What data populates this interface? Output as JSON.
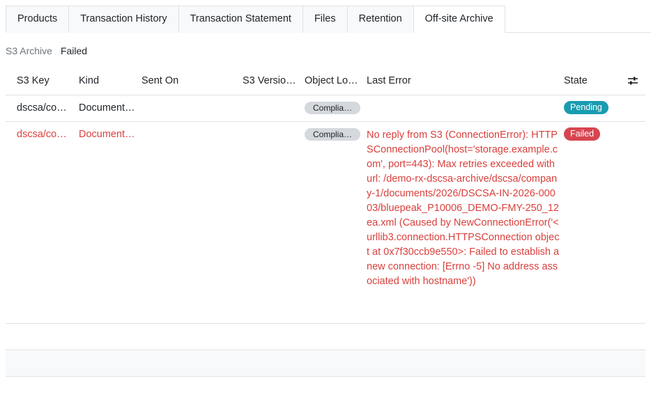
{
  "tabs": [
    {
      "label": "Products"
    },
    {
      "label": "Transaction History"
    },
    {
      "label": "Transaction Statement"
    },
    {
      "label": "Files"
    },
    {
      "label": "Retention"
    },
    {
      "label": "Off-site Archive",
      "active": true
    }
  ],
  "filter": {
    "label": "S3 Archive",
    "value": "Failed"
  },
  "table": {
    "columns": [
      "S3 Key",
      "Kind",
      "Sent On",
      "S3 Versio…",
      "Object Lo…",
      "Last Error",
      "State"
    ],
    "settings_icon": "sliders-icon",
    "rows": [
      {
        "s3_key": "dscsa/co…",
        "kind": "Document…",
        "sent_on": "",
        "s3_version": "",
        "object_lock": "Complia…",
        "last_error": "",
        "state": "Pending"
      },
      {
        "s3_key": "dscsa/co…",
        "kind": "Document…",
        "sent_on": "",
        "s3_version": "",
        "object_lock": "Complia…",
        "last_error": "No reply from S3 (ConnectionError): HTTPSConnectionPool(host='storage.example.com', port=443): Max retries exceeded with url: /demo-rx-dscsa-archive/dscsa/company-1/documents/2026/DSCSA-IN-2026-00003/bluepeak_P10006_DEMO-FMY-250_12ea.xml (Caused by NewConnectionError('<urllib3.connection.HTTPSConnection object at 0x7f30ccb9e550>: Failed to establish a new connection: [Errno -5] No address associated with hostname'))",
        "state": "Failed"
      }
    ]
  },
  "colors": {
    "error_text": "#d9403d",
    "pending_badge": "#1a9caf",
    "failed_badge": "#d64550",
    "border": "#dee2e6"
  }
}
